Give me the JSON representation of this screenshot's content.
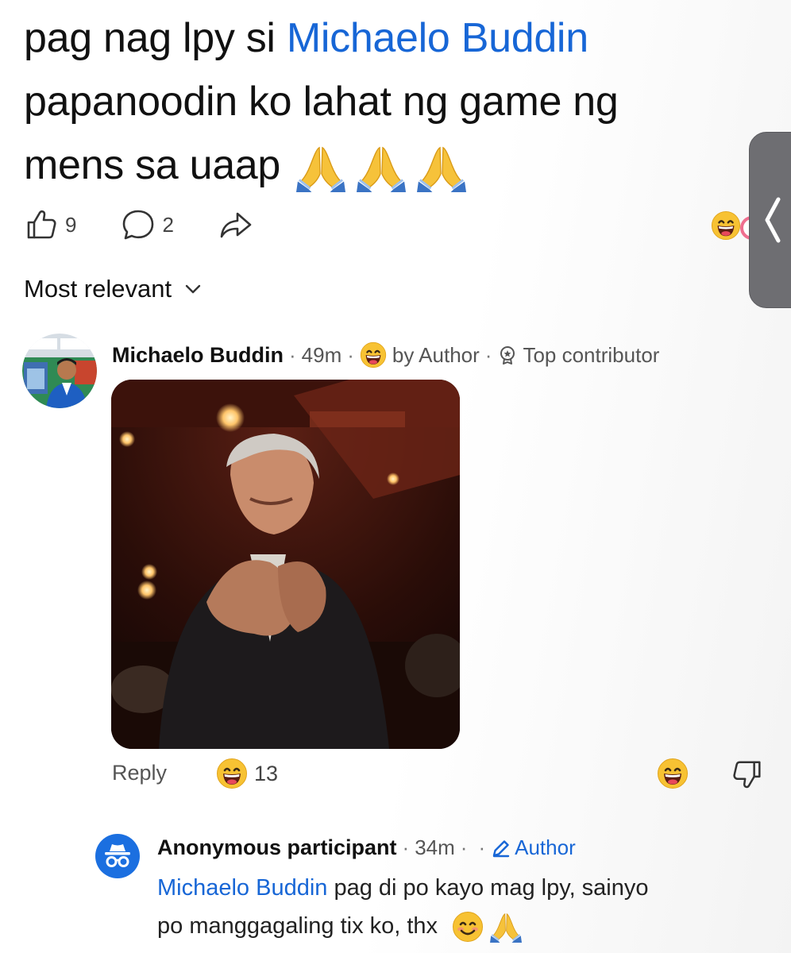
{
  "post": {
    "text_line1_prefix": "pag nag lpy si ",
    "mention": "Michaelo Buddin",
    "text_line2": "papanoodin ko lahat ng game ng",
    "text_line3": "mens sa uaap",
    "emojis": [
      "folded-hands-emoji",
      "folded-hands-emoji",
      "folded-hands-emoji"
    ]
  },
  "actions": {
    "like_count": "9",
    "comment_count": "2"
  },
  "sort": {
    "label": "Most relevant"
  },
  "comment1": {
    "author": "Michaelo Buddin",
    "dot": "·",
    "time": "49m",
    "by_author": "by Author",
    "badge": "Top contributor",
    "reply_label": "Reply",
    "reaction_count": "13"
  },
  "comment2": {
    "author": "Anonymous participant",
    "dot": "·",
    "time": "34m",
    "author_tag": "Author",
    "mention": "Michaelo Buddin",
    "text_line1": " pag di po kayo mag lpy, sainyo",
    "text_line2": "po manggagaling tix ko, thx"
  },
  "colors": {
    "mention_blue": "#1766d6",
    "anonymous_avatar": "#1b6fe0",
    "side_handle": "#6e6e72"
  }
}
